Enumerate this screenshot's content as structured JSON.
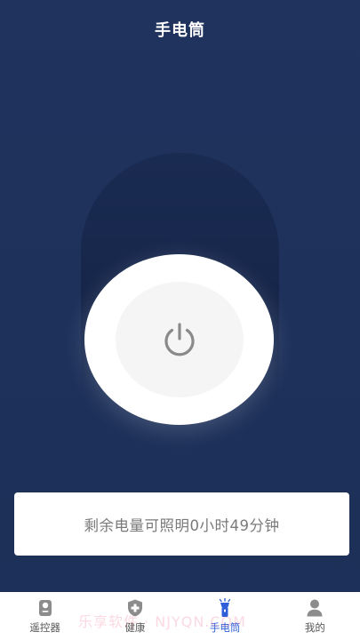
{
  "header": {
    "title": "手电筒"
  },
  "flashlight": {
    "power_icon": "power-icon",
    "state": "off"
  },
  "status": {
    "text": "剩余电量可照明0小时49分钟"
  },
  "tabs": [
    {
      "label": "遥控器",
      "icon": "remote-icon",
      "active": false
    },
    {
      "label": "健康",
      "icon": "health-shield-icon",
      "active": false
    },
    {
      "label": "手电筒",
      "icon": "flashlight-icon",
      "active": true
    },
    {
      "label": "我的",
      "icon": "profile-icon",
      "active": false
    }
  ],
  "watermark": {
    "text": "乐享软件 · NJYQN.COM"
  },
  "colors": {
    "background": "#1d3059",
    "tab_active": "#2f5fd8",
    "tab_inactive": "#555555",
    "status_text": "#7a7a7a"
  }
}
